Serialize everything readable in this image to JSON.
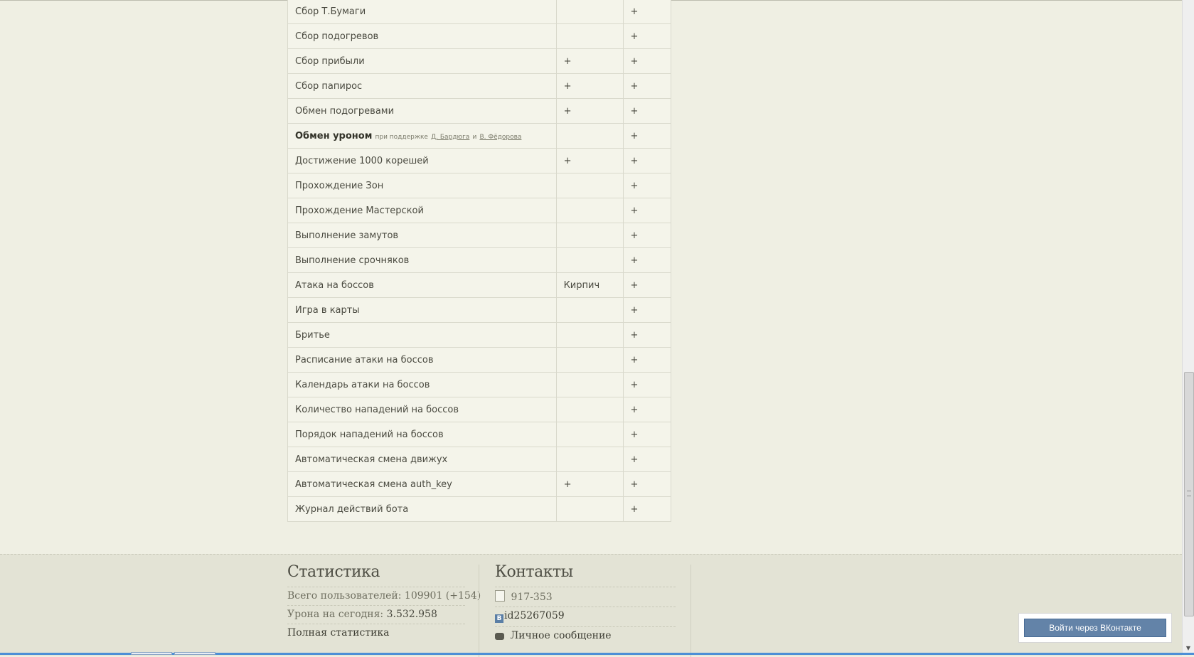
{
  "features": {
    "rows": [
      {
        "name": "Сбор Т.Бумаги",
        "col_a": "",
        "col_b": "+"
      },
      {
        "name": "Сбор подогревов",
        "col_a": "",
        "col_b": "+"
      },
      {
        "name": "Сбор прибыли",
        "col_a": "+",
        "col_b": "+"
      },
      {
        "name": "Сбор папирос",
        "col_a": "+",
        "col_b": "+"
      },
      {
        "name": "Обмен подогревами",
        "col_a": "+",
        "col_b": "+"
      },
      {
        "name": "Обмен уроном",
        "col_a": "",
        "col_b": "+"
      },
      {
        "name": "Достижение 1000 корешей",
        "col_a": "+",
        "col_b": "+"
      },
      {
        "name": "Прохождение Зон",
        "col_a": "",
        "col_b": "+"
      },
      {
        "name": "Прохождение Мастерской",
        "col_a": "",
        "col_b": "+"
      },
      {
        "name": "Выполнение замутов",
        "col_a": "",
        "col_b": "+"
      },
      {
        "name": "Выполнение срочняков",
        "col_a": "",
        "col_b": "+"
      },
      {
        "name": "Атака на боссов",
        "col_a": "Кирпич",
        "col_b": "+"
      },
      {
        "name": "Игра в карты",
        "col_a": "",
        "col_b": "+"
      },
      {
        "name": "Бритье",
        "col_a": "",
        "col_b": "+"
      },
      {
        "name": "Расписание атаки на боссов",
        "col_a": "",
        "col_b": "+"
      },
      {
        "name": "Календарь атаки на боссов",
        "col_a": "",
        "col_b": "+"
      },
      {
        "name": "Количество нападений на боссов",
        "col_a": "",
        "col_b": "+"
      },
      {
        "name": "Порядок нападений на боссов",
        "col_a": "",
        "col_b": "+"
      },
      {
        "name": "Автоматическая смена движух",
        "col_a": "",
        "col_b": "+"
      },
      {
        "name": "Автоматическая смена auth_key",
        "col_a": "+",
        "col_b": "+"
      },
      {
        "name": "Журнал действий бота",
        "col_a": "",
        "col_b": "+"
      }
    ],
    "damage_note": {
      "prefix": "при поддержке",
      "link1": "Д. Бардюга",
      "conj": "и",
      "link2": "В. Фёдорова"
    }
  },
  "stats": {
    "title": "Статистика",
    "users_label": "Всего пользователей:",
    "users_value": "109901 (+154)",
    "damage_label": "Урона на сегодня:",
    "damage_value": "3.532.958",
    "full_link": "Полная статистика"
  },
  "contacts": {
    "title": "Контакты",
    "phone": "917-353",
    "vk_id": "id25267059",
    "message": "Личное сообщение"
  },
  "vk_login": {
    "label": "Войти через ВКонтакте"
  },
  "icons": {
    "phone": "phone-icon",
    "vk": "vk-icon",
    "message": "message-icon"
  },
  "colors": {
    "background": "#efefe3",
    "footer": "#e3e3d5",
    "vk_button": "#6383a8"
  }
}
